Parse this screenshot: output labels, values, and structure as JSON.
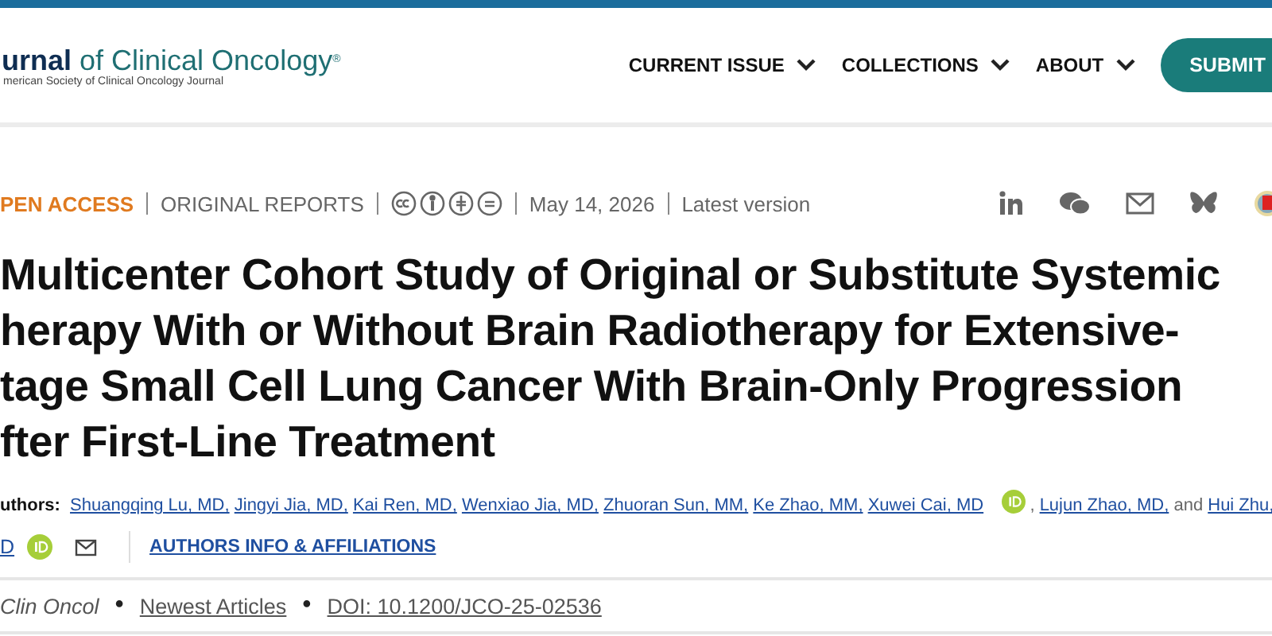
{
  "header": {
    "logo_main": "urnal",
    "logo_rest": " of Clinical Oncology",
    "logo_mark": "®",
    "logo_subtitle": "merican Society of Clinical Oncology Journal",
    "nav": [
      {
        "label": "CURRENT ISSUE"
      },
      {
        "label": "COLLECTIONS"
      },
      {
        "label": "ABOUT"
      }
    ],
    "submit": "SUBMIT"
  },
  "meta": {
    "access": "PEN ACCESS",
    "type": "ORIGINAL REPORTS",
    "date": "May 14, 2026",
    "version": "Latest version"
  },
  "title_lines": [
    "Multicenter Cohort Study of Original or Substitute Systemic",
    "herapy With or Without Brain Radiotherapy for Extensive-",
    "tage Small Cell Lung Cancer With Brain-Only Progression",
    "fter First-Line Treatment"
  ],
  "authors": {
    "label": "uthors:",
    "items": [
      {
        "kind": "link",
        "text": "Shuangqing Lu, MD,"
      },
      {
        "kind": "link",
        "text": "Jingyi Jia, MD,"
      },
      {
        "kind": "link",
        "text": "Kai Ren, MD,"
      },
      {
        "kind": "link",
        "text": "Wenxiao Jia, MD,"
      },
      {
        "kind": "link",
        "text": "Zhuoran Sun, MM,"
      },
      {
        "kind": "link",
        "text": "Ke Zhao, MM,"
      },
      {
        "kind": "link",
        "text": "Xuwei Cai, MD"
      },
      {
        "kind": "orcid"
      },
      {
        "kind": "text",
        "text": ","
      },
      {
        "kind": "link",
        "text": "Lujun Zhao, MD,"
      },
      {
        "kind": "text",
        "text": "and"
      },
      {
        "kind": "link",
        "text": "Hui Zhu,"
      }
    ],
    "continued": "D",
    "info_link": "AUTHORS INFO & AFFILIATIONS"
  },
  "citation": [
    {
      "kind": "journal",
      "text": "Clin Oncol"
    },
    {
      "kind": "bullet",
      "text": "•"
    },
    {
      "kind": "link",
      "text": "Newest Articles"
    },
    {
      "kind": "bullet",
      "text": "•"
    },
    {
      "kind": "link",
      "text": "DOI: 10.1200/JCO-25-02536"
    }
  ]
}
